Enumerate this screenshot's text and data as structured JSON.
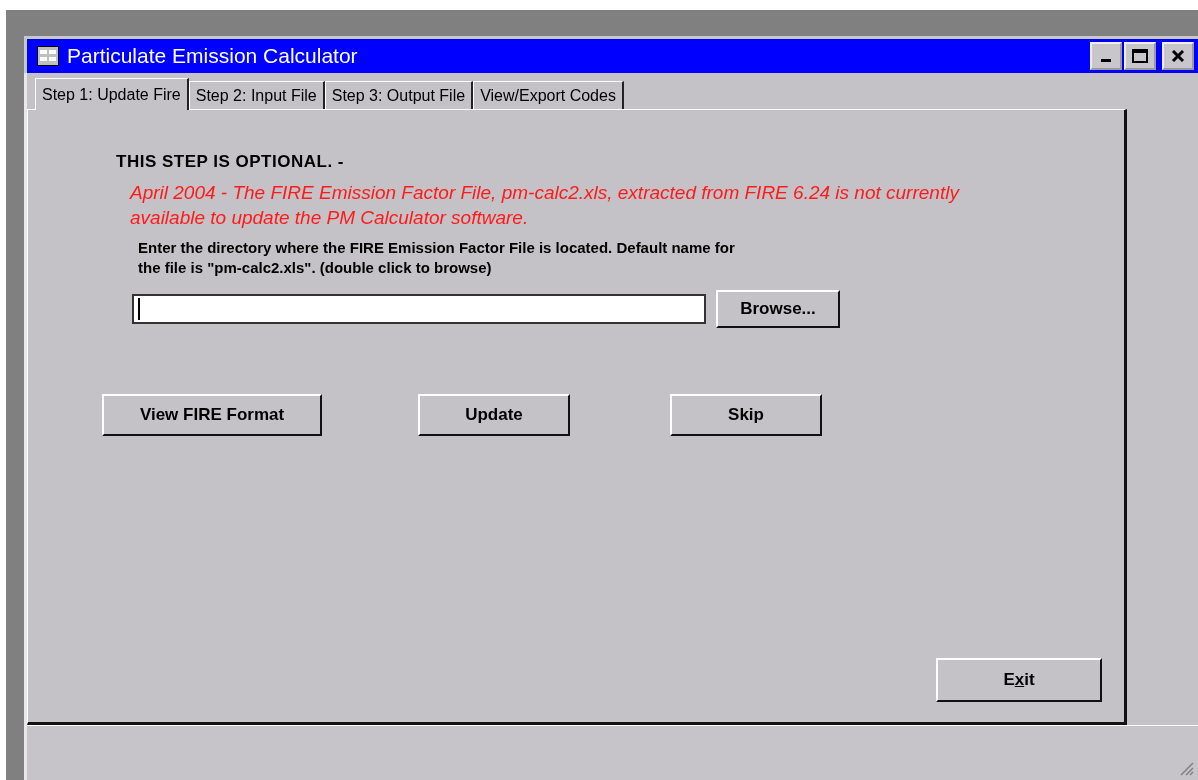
{
  "window": {
    "title": "Particulate Emission Calculator"
  },
  "tabs": [
    {
      "label": "Step 1: Update Fire",
      "selected": true
    },
    {
      "label": "Step 2:  Input File",
      "selected": false
    },
    {
      "label": "Step 3: Output File",
      "selected": false
    },
    {
      "label": "View/Export Codes",
      "selected": false
    }
  ],
  "heading": "THIS STEP IS OPTIONAL. -",
  "notice": "April 2004 - The FIRE Emission Factor File, pm-calc2.xls, extracted from FIRE 6.24 is not currently available to update the PM Calculator software.",
  "instructions": "Enter the directory where the FIRE Emission Factor File  is located. Default name for the file is \"pm-calc2.xls\".  (double click to browse)",
  "browse_button": "Browse...",
  "action_buttons": [
    "View FIRE  Format",
    "Update",
    "Skip"
  ],
  "exit_button": {
    "before": "E",
    "access_key": "x",
    "after": "it"
  }
}
